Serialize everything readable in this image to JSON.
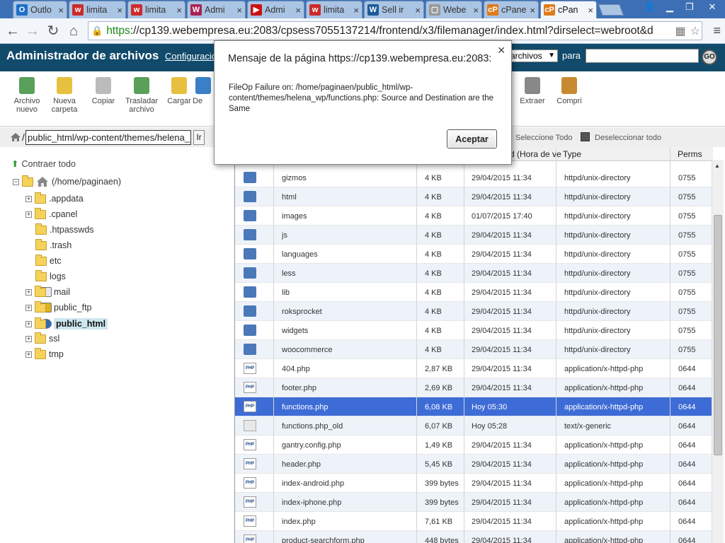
{
  "browser": {
    "tabs": [
      {
        "label": "Outlo",
        "fav": "O",
        "color": "#1e6fc8"
      },
      {
        "label": "limita",
        "fav": "w",
        "color": "#cc2b2b"
      },
      {
        "label": "limita",
        "fav": "w",
        "color": "#cc2b2b"
      },
      {
        "label": "Admi",
        "fav": "W",
        "color": "#aa2255"
      },
      {
        "label": "Admi",
        "fav": "▶",
        "color": "#cc1111"
      },
      {
        "label": "limita",
        "fav": "w",
        "color": "#cc2b2b"
      },
      {
        "label": "Sell ir",
        "fav": "W",
        "color": "#1e5a9a"
      },
      {
        "label": "Webe",
        "fav": "▢",
        "color": "#999999"
      },
      {
        "label": "cPane",
        "fav": "cP",
        "color": "#e07a1a"
      },
      {
        "label": "cPan",
        "fav": "cP",
        "color": "#e07a1a"
      }
    ],
    "active_tab": 9,
    "url_https": "https",
    "url_rest": "://cp139.webempresa.eu:2083/cpsess7055137214/frontend/x3/filemanager/index.html?dirselect=webroot&d"
  },
  "fm": {
    "title": "Administrador de archivos",
    "config_link": "Configuración",
    "search_select": "archivos",
    "search_for": "para",
    "go": "GO",
    "actions": [
      {
        "label": "Archivo nuevo",
        "icon": "new-file-icon"
      },
      {
        "label": "Nueva carpeta",
        "icon": "new-folder-icon"
      },
      {
        "label": "Copiar",
        "icon": "copy-icon"
      },
      {
        "label": "Trasladar archivo",
        "icon": "move-icon"
      },
      {
        "label": "Cargar",
        "icon": "upload-icon"
      },
      {
        "label": "De",
        "icon": "download-icon"
      },
      {
        "label": "Extraer",
        "icon": "extract-icon"
      },
      {
        "label": "Compri",
        "icon": "compress-icon"
      }
    ],
    "path_value": "public_html/wp-content/themes/helena_",
    "path_go": "Ir",
    "select_all": "Seleccione Todo",
    "deselect_all": "Deseleccionar todo",
    "collapse_all": "Contraer todo",
    "tree_root": "(/home/paginaen)",
    "tree": [
      {
        "label": ".appdata",
        "expandable": true,
        "icon": "folder-icon"
      },
      {
        "label": ".cpanel",
        "expandable": true,
        "icon": "folder-icon"
      },
      {
        "label": ".htpasswds",
        "expandable": false,
        "icon": "folder-icon"
      },
      {
        "label": ".trash",
        "expandable": false,
        "icon": "folder-icon"
      },
      {
        "label": "etc",
        "expandable": false,
        "icon": "folder-icon"
      },
      {
        "label": "logs",
        "expandable": false,
        "icon": "folder-icon"
      },
      {
        "label": "mail",
        "expandable": true,
        "icon": "mail-icon"
      },
      {
        "label": "public_ftp",
        "expandable": true,
        "icon": "ftp-icon"
      },
      {
        "label": "public_html",
        "expandable": true,
        "icon": "globe-icon",
        "highlight": true
      },
      {
        "label": "ssl",
        "expandable": true,
        "icon": "folder-icon"
      },
      {
        "label": "tmp",
        "expandable": true,
        "icon": "folder-icon"
      }
    ],
    "columns": {
      "date": "d (Hora de ve",
      "type": "Type",
      "perms": "Perms"
    },
    "rows": [
      {
        "name": "gizmos",
        "size": "4 KB",
        "date": "29/04/2015 11:34",
        "type": "httpd/unix-directory",
        "perms": "0755",
        "kind": "dir"
      },
      {
        "name": "html",
        "size": "4 KB",
        "date": "29/04/2015 11:34",
        "type": "httpd/unix-directory",
        "perms": "0755",
        "kind": "dir"
      },
      {
        "name": "images",
        "size": "4 KB",
        "date": "01/07/2015 17:40",
        "type": "httpd/unix-directory",
        "perms": "0755",
        "kind": "dir"
      },
      {
        "name": "js",
        "size": "4 KB",
        "date": "29/04/2015 11:34",
        "type": "httpd/unix-directory",
        "perms": "0755",
        "kind": "dir"
      },
      {
        "name": "languages",
        "size": "4 KB",
        "date": "29/04/2015 11:34",
        "type": "httpd/unix-directory",
        "perms": "0755",
        "kind": "dir"
      },
      {
        "name": "less",
        "size": "4 KB",
        "date": "29/04/2015 11:34",
        "type": "httpd/unix-directory",
        "perms": "0755",
        "kind": "dir"
      },
      {
        "name": "lib",
        "size": "4 KB",
        "date": "29/04/2015 11:34",
        "type": "httpd/unix-directory",
        "perms": "0755",
        "kind": "dir"
      },
      {
        "name": "roksprocket",
        "size": "4 KB",
        "date": "29/04/2015 11:34",
        "type": "httpd/unix-directory",
        "perms": "0755",
        "kind": "dir"
      },
      {
        "name": "widgets",
        "size": "4 KB",
        "date": "29/04/2015 11:34",
        "type": "httpd/unix-directory",
        "perms": "0755",
        "kind": "dir"
      },
      {
        "name": "woocommerce",
        "size": "4 KB",
        "date": "29/04/2015 11:34",
        "type": "httpd/unix-directory",
        "perms": "0755",
        "kind": "dir"
      },
      {
        "name": "404.php",
        "size": "2,87 KB",
        "date": "29/04/2015 11:34",
        "type": "application/x-httpd-php",
        "perms": "0644",
        "kind": "php"
      },
      {
        "name": "footer.php",
        "size": "2,69 KB",
        "date": "29/04/2015 11:34",
        "type": "application/x-httpd-php",
        "perms": "0644",
        "kind": "php"
      },
      {
        "name": "functions.php",
        "size": "6,08 KB",
        "date": "Hoy 05:30",
        "type": "application/x-httpd-php",
        "perms": "0644",
        "kind": "php",
        "selected": true
      },
      {
        "name": "functions.php_old",
        "size": "6,07 KB",
        "date": "Hoy 05:28",
        "type": "text/x-generic",
        "perms": "0644",
        "kind": "txt"
      },
      {
        "name": "gantry.config.php",
        "size": "1,49 KB",
        "date": "29/04/2015 11:34",
        "type": "application/x-httpd-php",
        "perms": "0644",
        "kind": "php"
      },
      {
        "name": "header.php",
        "size": "5,45 KB",
        "date": "29/04/2015 11:34",
        "type": "application/x-httpd-php",
        "perms": "0644",
        "kind": "php"
      },
      {
        "name": "index-android.php",
        "size": "399 bytes",
        "date": "29/04/2015 11:34",
        "type": "application/x-httpd-php",
        "perms": "0644",
        "kind": "php"
      },
      {
        "name": "index-iphone.php",
        "size": "399 bytes",
        "date": "29/04/2015 11:34",
        "type": "application/x-httpd-php",
        "perms": "0644",
        "kind": "php"
      },
      {
        "name": "index.php",
        "size": "7,61 KB",
        "date": "29/04/2015 11:34",
        "type": "application/x-httpd-php",
        "perms": "0644",
        "kind": "php"
      },
      {
        "name": "product-searchform.php",
        "size": "448 bytes",
        "date": "29/04/2015 11:34",
        "type": "application/x-httpd-php",
        "perms": "0644",
        "kind": "php"
      }
    ]
  },
  "dialog": {
    "title": "Mensaje de la página https://cp139.webempresa.eu:2083:",
    "message": "FileOp Failure on: /home/paginaen/public_html/wp-content/themes/helena_wp/functions.php: Source and Destination are the Same",
    "ok": "Aceptar"
  }
}
